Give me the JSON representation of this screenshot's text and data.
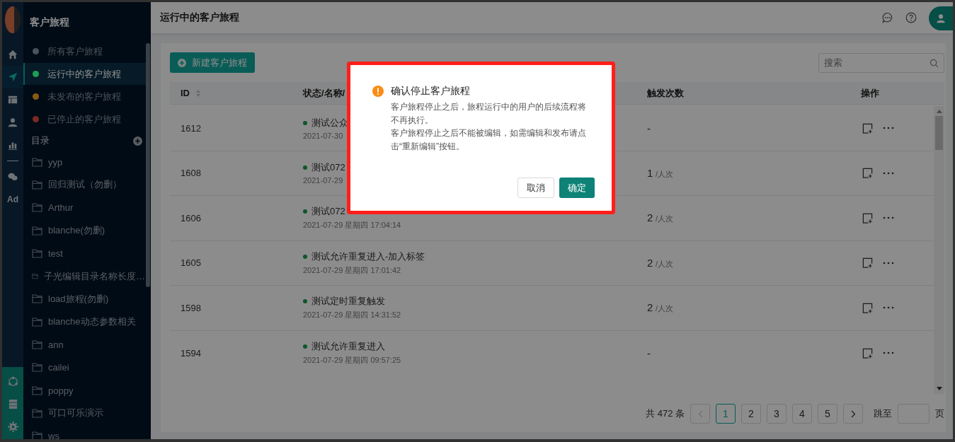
{
  "rail": {
    "items": [
      {
        "kind": "home",
        "selected": false
      },
      {
        "kind": "send",
        "selected": true
      },
      {
        "kind": "layout",
        "selected": false
      },
      {
        "kind": "user",
        "selected": false
      },
      {
        "kind": "chart",
        "selected": false
      },
      {
        "kind": "divider"
      },
      {
        "kind": "chat",
        "selected": false
      },
      {
        "kind": "text",
        "label": "Ad",
        "selected": false
      }
    ],
    "bottom_items": [
      {
        "kind": "network"
      },
      {
        "kind": "server"
      },
      {
        "kind": "gear"
      }
    ]
  },
  "sidebar": {
    "title": "客户旅程",
    "status_items": [
      {
        "label": "所有客户旅程",
        "color": "#4a525c",
        "selected": false
      },
      {
        "label": "运行中的客户旅程",
        "color": "#1f9d55",
        "selected": true
      },
      {
        "label": "未发布的客户旅程",
        "color": "#8a5a14",
        "selected": false
      },
      {
        "label": "已停止的客户旅程",
        "color": "#7a2a22",
        "selected": false
      }
    ],
    "catalog_title": "目录",
    "folders": [
      "yyp",
      "回归测试（勿删）",
      "Arthur",
      "blanche(勿删)",
      "test",
      "子光编辑目录名称长度…",
      "load旅程(勿删)",
      "blanche动态参数相关",
      "ann",
      "cailei",
      "poppy",
      "可口可乐演示",
      "ws"
    ]
  },
  "header": {
    "title": "运行中的客户旅程"
  },
  "toolbar": {
    "new_button": "新建客户旅程",
    "search": {
      "placeholder": "搜索"
    }
  },
  "table": {
    "columns": [
      {
        "label": "ID",
        "sortable": true
      },
      {
        "label": "状态/名称/"
      },
      {
        "label": "触发次数",
        "sortable": false
      },
      {
        "label": "操作",
        "sortable": false
      }
    ],
    "rows": [
      {
        "id": "1612",
        "name": "测试公众",
        "date": "2021-07-30",
        "count": "-"
      },
      {
        "id": "1608",
        "name": "测试072",
        "date": "2021-07-29",
        "count": "1",
        "unit": "/人次"
      },
      {
        "id": "1606",
        "name": "测试072",
        "date": "2021-07-29 星期四 17:04:14",
        "count": "2",
        "unit": "/人次"
      },
      {
        "id": "1605",
        "name": "测试允许重复进入-加入标签",
        "date": "2021-07-29 星期四 17:01:42",
        "count": "2",
        "unit": "/人次"
      },
      {
        "id": "1598",
        "name": "测试定时重复触发",
        "date": "2021-07-29 星期四 14:31:52",
        "count": "2",
        "unit": "/人次"
      },
      {
        "id": "1594",
        "name": "测试允许重复进入",
        "date": "2021-07-29 星期四 09:57:25",
        "count": "-"
      }
    ]
  },
  "pagination": {
    "total": "共 472 条",
    "prev_disabled": true,
    "pages": [
      {
        "label": "1",
        "selected": true
      },
      {
        "label": "2",
        "selected": false
      },
      {
        "label": "3",
        "selected": false
      },
      {
        "label": "4",
        "selected": false
      },
      {
        "label": "5",
        "selected": false
      }
    ],
    "jump_label": "跳至",
    "page_suffix": "页"
  },
  "dialog": {
    "title": "确认停止客户旅程",
    "paragraphs": [
      "客户旅程停止之后，旅程运行中的用户的后续流程将不再执行。",
      "客户旅程停止之后不能被编辑，如需编辑和发布请点击“重新编辑”按钮。"
    ],
    "cancel": "取消",
    "ok": "确定"
  }
}
